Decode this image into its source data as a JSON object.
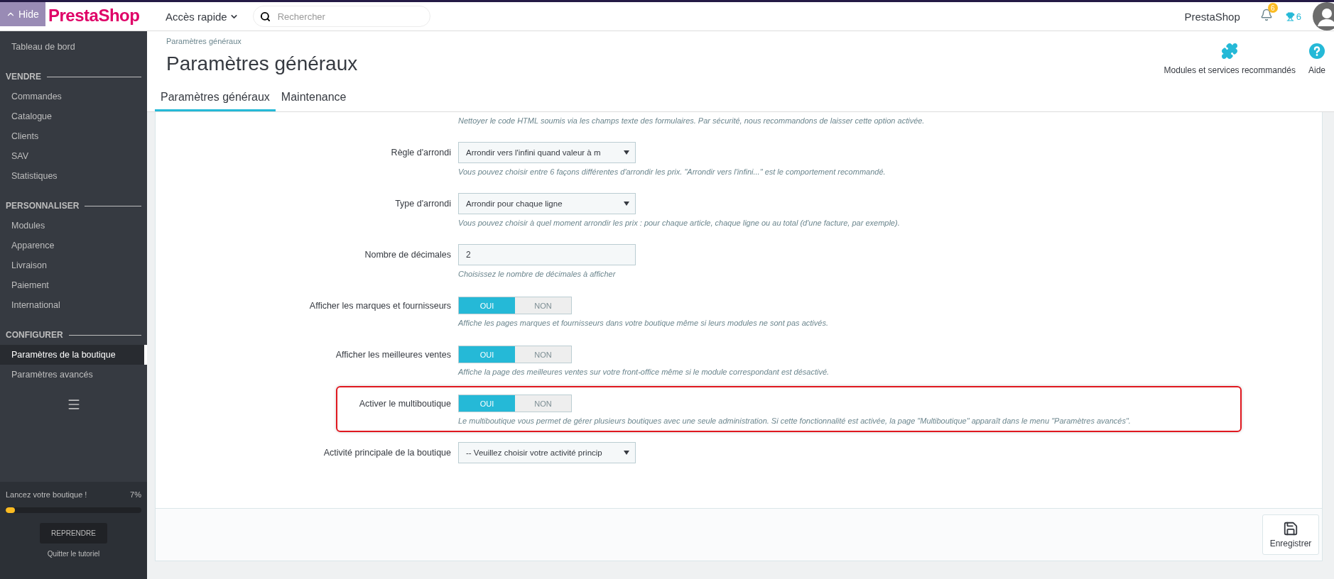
{
  "topbar": {
    "logo": "PrestaShop",
    "hide_button": "Hide",
    "quick_access": "Accès rapide",
    "search": {
      "placeholder": "Rechercher"
    },
    "shop_name": "PrestaShop",
    "notifications": "6",
    "trophies": "6"
  },
  "sidebar": {
    "sections": [
      {
        "items": [
          {
            "label": "Tableau de bord",
            "selected": false
          }
        ]
      },
      {
        "title": "VENDRE",
        "items": [
          {
            "label": "Commandes",
            "selected": false
          },
          {
            "label": "Catalogue",
            "selected": false
          },
          {
            "label": "Clients",
            "selected": false
          },
          {
            "label": "SAV",
            "selected": false
          },
          {
            "label": "Statistiques",
            "selected": false
          }
        ]
      },
      {
        "title": "PERSONNALISER",
        "items": [
          {
            "label": "Modules",
            "selected": false
          },
          {
            "label": "Apparence",
            "selected": false
          },
          {
            "label": "Livraison",
            "selected": false
          },
          {
            "label": "Paiement",
            "selected": false
          },
          {
            "label": "International",
            "selected": false
          }
        ]
      },
      {
        "title": "CONFIGURER",
        "items": [
          {
            "label": "Paramètres de la boutique",
            "selected": true
          },
          {
            "label": "Paramètres avancés",
            "selected": false
          }
        ]
      }
    ],
    "onboarding": {
      "title": "Lancez votre boutique !",
      "percent": "7%",
      "level": 0.07,
      "button": "REPRENDRE",
      "link": "Quitter le tutoriel"
    }
  },
  "header": {
    "breadcrumb": "Paramètres généraux",
    "title": "Paramètres généraux",
    "toolbar": [
      {
        "kind": "modules",
        "label": "Modules et services recommandés"
      },
      {
        "kind": "help",
        "label": "Aide"
      }
    ]
  },
  "tabs": [
    {
      "label": "Paramètres généraux",
      "selected": true
    },
    {
      "label": "Maintenance",
      "selected": false
    }
  ],
  "form": {
    "intro_help": "Nettoyer le code HTML soumis via les champs texte des formulaires. Par sécurité, nous recommandons de laisser cette option activée.",
    "fields": [
      {
        "kind": "select",
        "label": "Règle d'arrondi",
        "value": "Arrondir vers l'infini quand valeur à m",
        "help": "Vous pouvez choisir entre 6 façons différentes d'arrondir les prix. \"Arrondir vers l'infini...\" est le comportement recommandé."
      },
      {
        "kind": "select",
        "label": "Type d'arrondi",
        "value": "Arrondir pour chaque ligne",
        "help": "Vous pouvez choisir à quel moment arrondir les prix : pour chaque article, chaque ligne ou au total (d'une facture, par exemple)."
      },
      {
        "kind": "input",
        "label": "Nombre de décimales",
        "value": "2",
        "help": "Choisissez le nombre de décimales à afficher"
      },
      {
        "kind": "switch",
        "label": "Afficher les marques et fournisseurs",
        "options": [
          {
            "label": "OUI",
            "selected": true
          },
          {
            "label": "NON",
            "selected": false
          }
        ],
        "help": "Affiche les pages marques et fournisseurs dans votre boutique même si leurs modules ne sont pas activés."
      },
      {
        "kind": "switch",
        "label": "Afficher les meilleures ventes",
        "options": [
          {
            "label": "OUI",
            "selected": true
          },
          {
            "label": "NON",
            "selected": false
          }
        ],
        "help": "Affiche la page des meilleures ventes sur votre front-office même si le module correspondant est désactivé."
      },
      {
        "kind": "switch",
        "label": "Activer le multiboutique",
        "options": [
          {
            "label": "OUI",
            "selected": true
          },
          {
            "label": "NON",
            "selected": false
          }
        ],
        "help": "Le multiboutique vous permet de gérer plusieurs boutiques avec une seule administration. Si cette fonctionnalité est activée, la page \"Multiboutique\" apparaît dans le menu \"Paramètres avancés\".",
        "highlighted": true
      },
      {
        "kind": "select",
        "label": "Activité principale de la boutique",
        "value": "-- Veuillez choisir votre activité princip"
      }
    ],
    "save_button": "Enregistrer"
  }
}
